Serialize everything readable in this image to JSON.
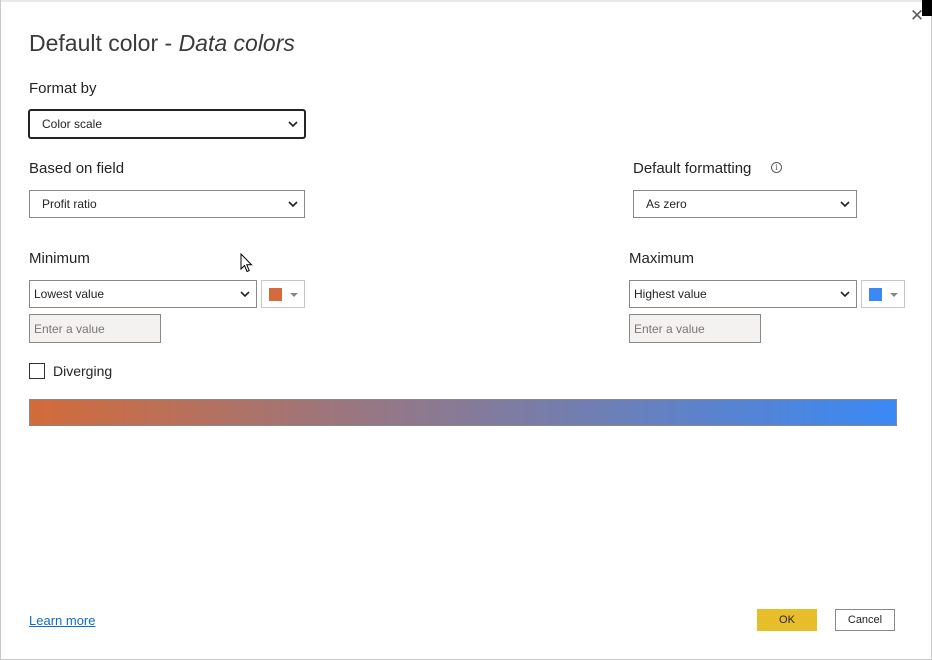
{
  "dialog": {
    "title_main": "Default color - ",
    "title_sub": "Data colors",
    "close_glyph": "✕"
  },
  "format_by": {
    "label": "Format by",
    "selected": "Color scale"
  },
  "based_on_field": {
    "label": "Based on field",
    "selected": "Profit ratio"
  },
  "default_formatting": {
    "label": "Default formatting",
    "info_glyph": "i",
    "selected": "As zero"
  },
  "minimum": {
    "label": "Minimum",
    "selected": "Lowest value",
    "color": "#d36b3a",
    "input_placeholder": "Enter a value"
  },
  "maximum": {
    "label": "Maximum",
    "selected": "Highest value",
    "color": "#3a89f5",
    "input_placeholder": "Enter a value"
  },
  "diverging": {
    "label": "Diverging",
    "checked": false
  },
  "gradient": {
    "start_color": "#d36b3a",
    "end_color": "#3a89f5"
  },
  "footer": {
    "learn_more": "Learn more",
    "ok_label": "OK",
    "cancel_label": "Cancel"
  }
}
